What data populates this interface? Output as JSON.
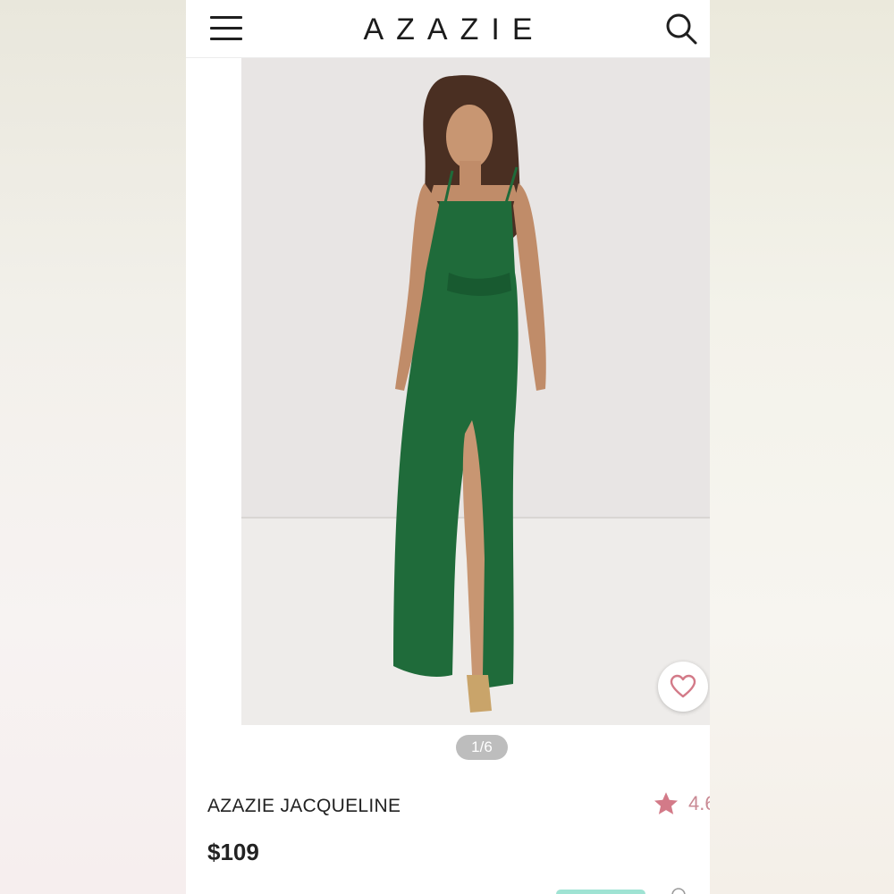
{
  "header": {
    "brand": "AZAZIE",
    "menu_icon": "hamburger-menu-icon",
    "search_icon": "search-icon"
  },
  "gallery": {
    "pager": "1/6",
    "favorite_icon": "heart-outline-icon",
    "dress_color": "#1f6b3a"
  },
  "product": {
    "name": "AZAZIE JACQUELINE",
    "rating": "4.6",
    "price": "$109"
  },
  "colors": {
    "star": "#d37a88",
    "heart": "#d37a88",
    "pager_bg": "#bdbdbd"
  }
}
